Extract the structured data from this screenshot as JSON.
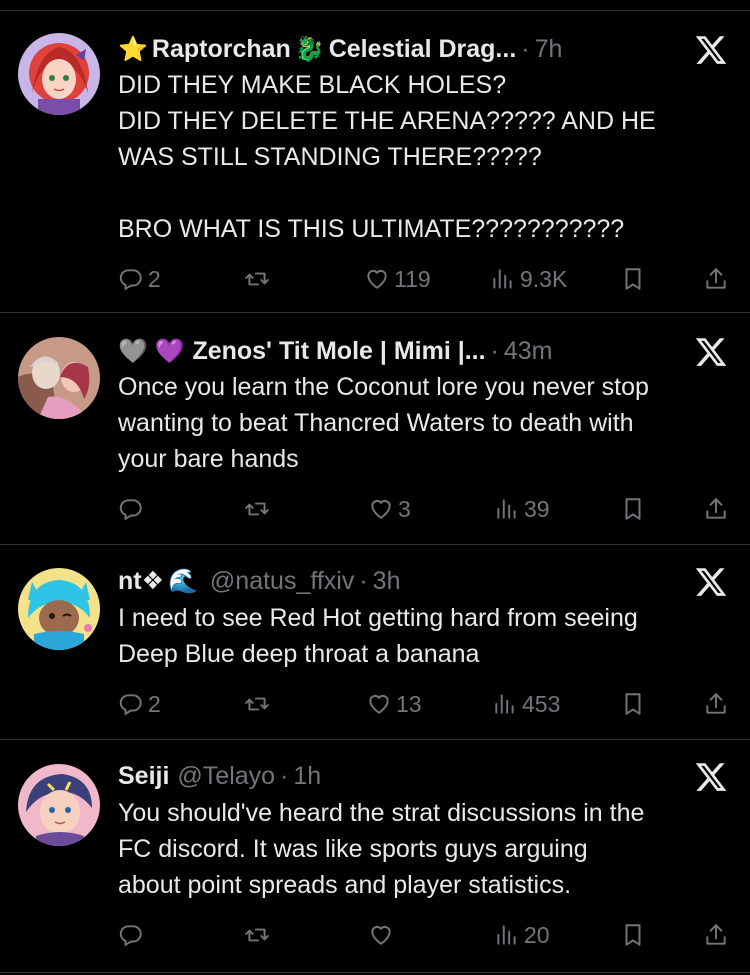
{
  "tweets": [
    {
      "name": "Raptorchan",
      "name_rest": "Celestial Drag...",
      "prefix_emoji": "⭐",
      "suffix_emoji": "🐉",
      "handle": "",
      "dot": "·",
      "time": "7h",
      "body": [
        "DID THEY MAKE BLACK HOLES?",
        "DID THEY DELETE THE ARENA????? AND HE",
        "WAS STILL STANDING THERE?????",
        "",
        "BRO WHAT IS THIS ULTIMATE???????????"
      ],
      "replies": "2",
      "retweets": "",
      "likes": "119",
      "views": "9.3K"
    },
    {
      "name": "Zenos' Tit Mole | Mimi |...",
      "prefix_emoji": "🩶 💜",
      "handle": "",
      "dot": "·",
      "time": "43m",
      "body": [
        "Once you learn the Coconut lore you never stop",
        "wanting to beat Thancred Waters to death with",
        "your bare hands"
      ],
      "replies": "",
      "retweets": "",
      "likes": "3",
      "views": "39"
    },
    {
      "name": "nt❖",
      "suffix_emoji": "🌊",
      "handle": "@natus_ffxiv",
      "dot": "·",
      "time": "3h",
      "body": [
        "I need to see Red Hot getting hard from seeing",
        "Deep Blue deep throat a banana"
      ],
      "replies": "2",
      "retweets": "",
      "likes": "13",
      "views": "453"
    },
    {
      "name": "Seiji",
      "handle": "@Telayo",
      "dot": "·",
      "time": "1h",
      "body": [
        "You should've heard the strat discussions in the",
        "FC discord. It was like sports guys arguing",
        "about point spreads and player statistics."
      ],
      "replies": "",
      "retweets": "",
      "likes": "",
      "views": "20"
    }
  ],
  "icons": {
    "reply": "reply-icon",
    "retweet": "retweet-icon",
    "like": "heart-icon",
    "views": "views-icon",
    "bookmark": "bookmark-icon",
    "share": "share-icon",
    "brand": "x-logo-icon"
  },
  "colors": {
    "background": "#000000",
    "text": "#e7e9ea",
    "muted": "#71767b",
    "divider": "#2f3336"
  }
}
